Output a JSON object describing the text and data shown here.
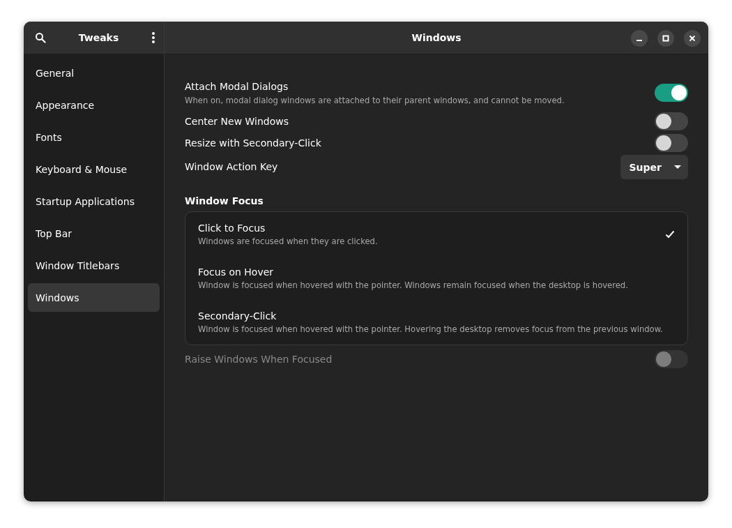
{
  "sidebar": {
    "title": "Tweaks",
    "items": [
      {
        "label": "General",
        "selected": false
      },
      {
        "label": "Appearance",
        "selected": false
      },
      {
        "label": "Fonts",
        "selected": false
      },
      {
        "label": "Keyboard & Mouse",
        "selected": false
      },
      {
        "label": "Startup Applications",
        "selected": false
      },
      {
        "label": "Top Bar",
        "selected": false
      },
      {
        "label": "Window Titlebars",
        "selected": false
      },
      {
        "label": "Windows",
        "selected": true
      }
    ]
  },
  "window": {
    "title": "Windows"
  },
  "settings": [
    {
      "kind": "switch",
      "label": "Attach Modal Dialogs",
      "description": "When on, modal dialog windows are attached to their parent windows, and cannot be moved.",
      "on": true,
      "disabled": false
    },
    {
      "kind": "switch",
      "label": "Center New Windows",
      "on": false,
      "disabled": false
    },
    {
      "kind": "switch",
      "label": "Resize with Secondary-Click",
      "on": false,
      "disabled": false
    },
    {
      "kind": "dropdown",
      "label": "Window Action Key",
      "value": "Super"
    }
  ],
  "focus": {
    "heading": "Window Focus",
    "options": [
      {
        "label": "Click to Focus",
        "description": "Windows are focused when they are clicked.",
        "selected": true
      },
      {
        "label": "Focus on Hover",
        "description": "Window is focused when hovered with the pointer. Windows remain focused when the desktop is hovered.",
        "selected": false
      },
      {
        "label": "Secondary-Click",
        "description": "Window is focused when hovered with the pointer. Hovering the desktop removes focus from the previous window.",
        "selected": false
      }
    ]
  },
  "after_settings": [
    {
      "kind": "switch",
      "label": "Raise Windows When Focused",
      "on": false,
      "disabled": true
    }
  ]
}
